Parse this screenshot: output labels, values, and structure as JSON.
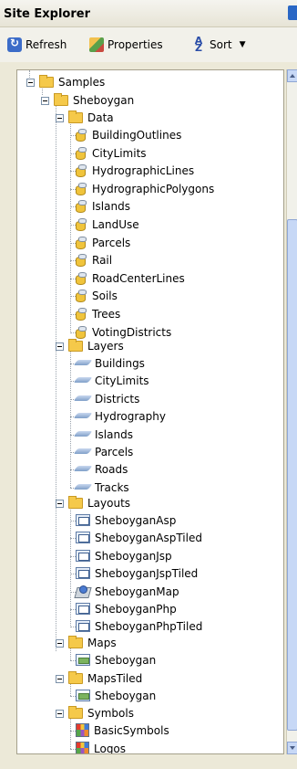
{
  "window": {
    "title": "Site Explorer"
  },
  "toolbar": {
    "refresh_label": "Refresh",
    "properties_label": "Properties",
    "sort_label": "Sort"
  },
  "tree": {
    "samples": "Samples",
    "sheboygan": "Sheboygan",
    "data": {
      "label": "Data",
      "items": [
        "BuildingOutlines",
        "CityLimits",
        "HydrographicLines",
        "HydrographicPolygons",
        "Islands",
        "LandUse",
        "Parcels",
        "Rail",
        "RoadCenterLines",
        "Soils",
        "Trees",
        "VotingDistricts"
      ]
    },
    "layers": {
      "label": "Layers",
      "items": [
        "Buildings",
        "CityLimits",
        "Districts",
        "Hydrography",
        "Islands",
        "Parcels",
        "Roads",
        "Tracks"
      ]
    },
    "layouts": {
      "label": "Layouts",
      "items": [
        "SheboyganAsp",
        "SheboyganAspTiled",
        "SheboyganJsp",
        "SheboyganJspTiled",
        "SheboyganMap",
        "SheboyganPhp",
        "SheboyganPhpTiled"
      ]
    },
    "maps": {
      "label": "Maps",
      "items": [
        "Sheboygan"
      ]
    },
    "mapstiled": {
      "label": "MapsTiled",
      "items": [
        "Sheboygan"
      ]
    },
    "symbols": {
      "label": "Symbols",
      "items": [
        "BasicSymbols",
        "Logos"
      ]
    }
  },
  "colors": {
    "accent": "#2a67c5",
    "folder": "#f5c94a",
    "background": "#ece9d8"
  }
}
